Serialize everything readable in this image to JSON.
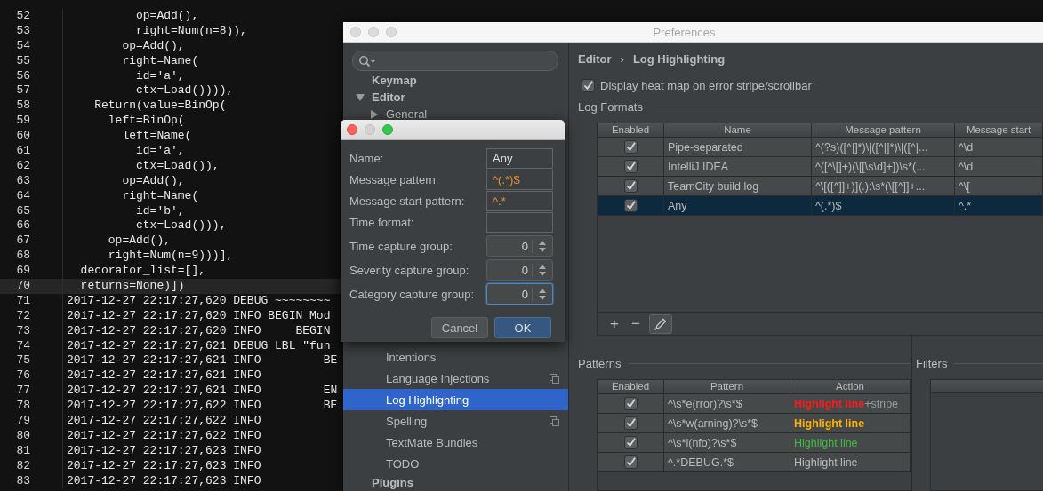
{
  "editor": {
    "lines": [
      {
        "number": "52",
        "text": "          op=Add(),",
        "current": false
      },
      {
        "number": "53",
        "text": "          right=Num(n=8)),",
        "current": false
      },
      {
        "number": "54",
        "text": "        op=Add(),",
        "current": false
      },
      {
        "number": "55",
        "text": "        right=Name(",
        "current": false
      },
      {
        "number": "56",
        "text": "          id='a',",
        "current": false
      },
      {
        "number": "57",
        "text": "          ctx=Load()))),",
        "current": false
      },
      {
        "number": "58",
        "text": "    Return(value=BinOp(",
        "current": false
      },
      {
        "number": "59",
        "text": "      left=BinOp(",
        "current": false
      },
      {
        "number": "60",
        "text": "        left=Name(",
        "current": false
      },
      {
        "number": "61",
        "text": "          id='a',",
        "current": false
      },
      {
        "number": "62",
        "text": "          ctx=Load()),",
        "current": false
      },
      {
        "number": "63",
        "text": "        op=Add(),",
        "current": false
      },
      {
        "number": "64",
        "text": "        right=Name(",
        "current": false
      },
      {
        "number": "65",
        "text": "          id='b',",
        "current": false
      },
      {
        "number": "66",
        "text": "          ctx=Load())),",
        "current": false
      },
      {
        "number": "67",
        "text": "      op=Add(),",
        "current": false
      },
      {
        "number": "68",
        "text": "      right=Num(n=9)))],",
        "current": false
      },
      {
        "number": "69",
        "text": "  decorator_list=[],",
        "current": false
      },
      {
        "number": "70",
        "text": "  returns=None)])",
        "current": true
      },
      {
        "number": "71",
        "text": "2017-12-27 22:17:27,620 DEBUG ~~~~~~~~",
        "current": false
      },
      {
        "number": "72",
        "text": "2017-12-27 22:17:27,620 INFO BEGIN Mod",
        "current": false
      },
      {
        "number": "73",
        "text": "2017-12-27 22:17:27,620 INFO     BEGIN",
        "current": false
      },
      {
        "number": "74",
        "text": "2017-12-27 22:17:27,621 DEBUG LBL \"fun",
        "current": false
      },
      {
        "number": "75",
        "text": "2017-12-27 22:17:27,621 INFO         BE",
        "current": false
      },
      {
        "number": "76",
        "text": "2017-12-27 22:17:27,621 INFO",
        "current": false
      },
      {
        "number": "77",
        "text": "2017-12-27 22:17:27,621 INFO         EN",
        "current": false
      },
      {
        "number": "78",
        "text": "2017-12-27 22:17:27,622 INFO         BE",
        "current": false
      },
      {
        "number": "79",
        "text": "2017-12-27 22:17:27,622 INFO",
        "current": false
      },
      {
        "number": "80",
        "text": "2017-12-27 22:17:27,622 INFO",
        "current": false
      },
      {
        "number": "81",
        "text": "2017-12-27 22:17:27,623 INFO",
        "current": false
      },
      {
        "number": "82",
        "text": "2017-12-27 22:17:27,623 INFO",
        "current": false
      },
      {
        "number": "83",
        "text": "2017-12-27 22:17:27,623 INFO",
        "current": false
      }
    ]
  },
  "preferences": {
    "title": "Preferences",
    "active": false,
    "sidebar": {
      "tree": [
        {
          "label": "Keymap",
          "selected": false
        },
        {
          "label": "Editor",
          "selected": false,
          "expanded": true,
          "children": [
            {
              "label": "General",
              "selected": false,
              "expanded": false,
              "project_scope": false
            },
            {
              "label": "Intentions",
              "selected": false,
              "project_scope": false
            },
            {
              "label": "Language Injections",
              "selected": false,
              "project_scope": true
            },
            {
              "label": "Log Highlighting",
              "selected": true,
              "project_scope": false
            },
            {
              "label": "Spelling",
              "selected": false,
              "project_scope": true
            },
            {
              "label": "TextMate Bundles",
              "selected": false,
              "project_scope": false
            },
            {
              "label": "TODO",
              "selected": false,
              "project_scope": false
            }
          ]
        },
        {
          "label": "Plugins",
          "selected": false
        }
      ]
    },
    "breadcrumb": {
      "items": [
        "Editor",
        "Log Highlighting"
      ],
      "separator": "›"
    },
    "heat_map_option": {
      "label": "Display heat map on error stripe/scrollbar",
      "checked": true
    },
    "log_formats": {
      "title": "Log Formats",
      "columns": [
        "Enabled",
        "Name",
        "Message pattern",
        "Message start"
      ],
      "rows": [
        {
          "enabled": true,
          "name": "Pipe-separated",
          "message_pattern": "^(?s)([^|]*)\\|([^|]*)\\|([^|...",
          "message_start": "^\\d",
          "selected": false
        },
        {
          "enabled": true,
          "name": "IntelliJ IDEA",
          "message_pattern": "^([^\\[]+)(\\[[\\s\\d]+])\\s*(...",
          "message_start": "^\\d",
          "selected": false
        },
        {
          "enabled": true,
          "name": "TeamCity build log",
          "message_pattern": "^\\[([^]]+)](.):\\s*(\\[[^]]+...",
          "message_start": "^\\[",
          "selected": false
        },
        {
          "enabled": true,
          "name": "Any",
          "message_pattern": "^(.*)$",
          "message_start": "^.*",
          "selected": true
        }
      ],
      "toolbar": [
        {
          "kind": "add",
          "text": "+"
        },
        {
          "kind": "remove",
          "text": "−"
        },
        {
          "kind": "edit",
          "pressed": true
        }
      ]
    },
    "patterns": {
      "title": "Patterns",
      "columns": [
        "Enabled",
        "Pattern",
        "Action"
      ],
      "rows": [
        {
          "enabled": true,
          "pattern": "^\\s*e(rror)?\\s*$",
          "action": {
            "text": "Highlight line",
            "color": "#ff1a1a",
            "bold": true,
            "suffix": "+stripe"
          }
        },
        {
          "enabled": true,
          "pattern": "^\\s*w(arning)?\\s*$",
          "action": {
            "text": "Highlight line",
            "color": "#ffb000",
            "bold": true
          }
        },
        {
          "enabled": true,
          "pattern": "^\\s*i(nfo)?\\s*$",
          "action": {
            "text": "Highlight line",
            "color": "#3fbf3f",
            "bold": false
          }
        },
        {
          "enabled": true,
          "pattern": "^.*DEBUG.*$",
          "action": {
            "text": "Highlight line",
            "color": "#bbbbbb",
            "bold": false
          }
        }
      ]
    },
    "filters": {
      "title": "Filters"
    }
  },
  "dialog": {
    "active": true,
    "fields": [
      {
        "kind": "text",
        "label": "Name:",
        "value": "Any"
      },
      {
        "kind": "pattern",
        "label": "Message pattern:",
        "value": "^(.*)$"
      },
      {
        "kind": "pattern",
        "label": "Message start pattern:",
        "value": "^.*"
      },
      {
        "kind": "text",
        "label": "Time format:"
      },
      {
        "kind": "spinner",
        "label": "Time capture group:",
        "value": "0",
        "focused": false
      },
      {
        "kind": "spinner",
        "label": "Severity capture group:",
        "value": "0",
        "focused": false
      },
      {
        "kind": "spinner",
        "label": "Category capture group:",
        "value": "0",
        "focused": true
      }
    ],
    "buttons": [
      {
        "label": "Cancel",
        "default": false
      },
      {
        "label": "OK",
        "default": true
      }
    ]
  }
}
